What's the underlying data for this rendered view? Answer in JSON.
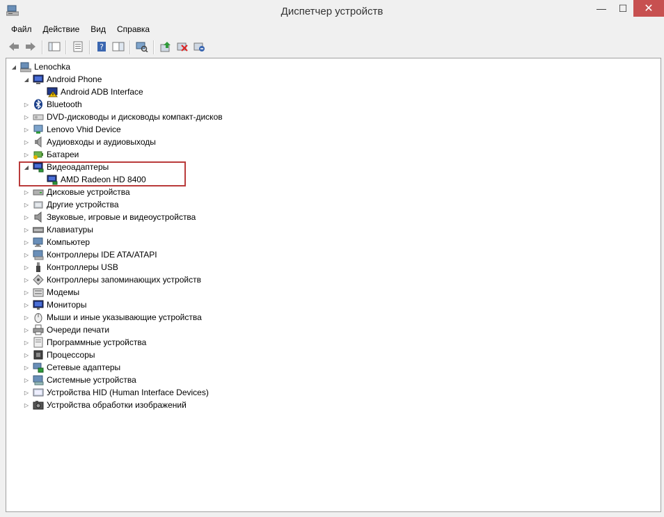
{
  "window": {
    "title": "Диспетчер устройств",
    "minimize_glyph": "—",
    "maximize_glyph": "☐",
    "close_glyph": "✕"
  },
  "menu": [
    "Файл",
    "Действие",
    "Вид",
    "Справка"
  ],
  "toolbar": [
    {
      "icon": "back-arrow-icon"
    },
    {
      "icon": "forward-arrow-icon"
    },
    {
      "sep": true
    },
    {
      "icon": "show-hide-tree-icon"
    },
    {
      "sep": true
    },
    {
      "icon": "properties-icon"
    },
    {
      "sep": true
    },
    {
      "icon": "help-icon"
    },
    {
      "icon": "action-pane-icon"
    },
    {
      "sep": true
    },
    {
      "icon": "scan-hardware-icon"
    },
    {
      "sep": true
    },
    {
      "icon": "update-driver-icon"
    },
    {
      "icon": "disable-device-icon"
    },
    {
      "icon": "uninstall-device-icon"
    }
  ],
  "tree": [
    {
      "label": "Lenochka",
      "level": 0,
      "state": "expanded",
      "icon": "computer-root-icon"
    },
    {
      "label": "Android Phone",
      "level": 1,
      "state": "expanded",
      "icon": "android-phone-icon"
    },
    {
      "label": "Android ADB Interface",
      "level": 2,
      "state": "leaf",
      "icon": "adb-interface-icon"
    },
    {
      "label": "Bluetooth",
      "level": 1,
      "state": "collapsed",
      "icon": "bluetooth-icon"
    },
    {
      "label": "DVD-дисководы и дисководы компакт-дисков",
      "level": 1,
      "state": "collapsed",
      "icon": "dvd-drive-icon"
    },
    {
      "label": "Lenovo Vhid Device",
      "level": 1,
      "state": "collapsed",
      "icon": "vhid-device-icon"
    },
    {
      "label": "Аудиовходы и аудиовыходы",
      "level": 1,
      "state": "collapsed",
      "icon": "speaker-icon"
    },
    {
      "label": "Батареи",
      "level": 1,
      "state": "collapsed",
      "icon": "battery-icon"
    },
    {
      "label": "Видеоадаптеры",
      "level": 1,
      "state": "expanded",
      "icon": "display-adapter-icon"
    },
    {
      "label": "AMD Radeon HD 8400",
      "level": 2,
      "state": "leaf",
      "icon": "gpu-card-icon"
    },
    {
      "label": "Дисковые устройства",
      "level": 1,
      "state": "collapsed",
      "icon": "disk-drive-icon"
    },
    {
      "label": "Другие устройства",
      "level": 1,
      "state": "collapsed",
      "icon": "other-devices-icon"
    },
    {
      "label": "Звуковые, игровые и видеоустройства",
      "level": 1,
      "state": "collapsed",
      "icon": "sound-video-icon"
    },
    {
      "label": "Клавиатуры",
      "level": 1,
      "state": "collapsed",
      "icon": "keyboard-icon"
    },
    {
      "label": "Компьютер",
      "level": 1,
      "state": "collapsed",
      "icon": "computer-icon"
    },
    {
      "label": "Контроллеры IDE ATA/ATAPI",
      "level": 1,
      "state": "collapsed",
      "icon": "ide-controller-icon"
    },
    {
      "label": "Контроллеры USB",
      "level": 1,
      "state": "collapsed",
      "icon": "usb-icon"
    },
    {
      "label": "Контроллеры запоминающих устройств",
      "level": 1,
      "state": "collapsed",
      "icon": "storage-controller-icon"
    },
    {
      "label": "Модемы",
      "level": 1,
      "state": "collapsed",
      "icon": "modem-icon"
    },
    {
      "label": "Мониторы",
      "level": 1,
      "state": "collapsed",
      "icon": "monitor-icon"
    },
    {
      "label": "Мыши и иные указывающие устройства",
      "level": 1,
      "state": "collapsed",
      "icon": "mouse-icon"
    },
    {
      "label": "Очереди печати",
      "level": 1,
      "state": "collapsed",
      "icon": "printer-icon"
    },
    {
      "label": "Программные устройства",
      "level": 1,
      "state": "collapsed",
      "icon": "software-device-icon"
    },
    {
      "label": "Процессоры",
      "level": 1,
      "state": "collapsed",
      "icon": "processor-icon"
    },
    {
      "label": "Сетевые адаптеры",
      "level": 1,
      "state": "collapsed",
      "icon": "network-adapter-icon"
    },
    {
      "label": "Системные устройства",
      "level": 1,
      "state": "collapsed",
      "icon": "system-device-icon"
    },
    {
      "label": "Устройства HID (Human Interface Devices)",
      "level": 1,
      "state": "collapsed",
      "icon": "hid-device-icon"
    },
    {
      "label": "Устройства обработки изображений",
      "level": 1,
      "state": "collapsed",
      "icon": "imaging-device-icon"
    }
  ]
}
